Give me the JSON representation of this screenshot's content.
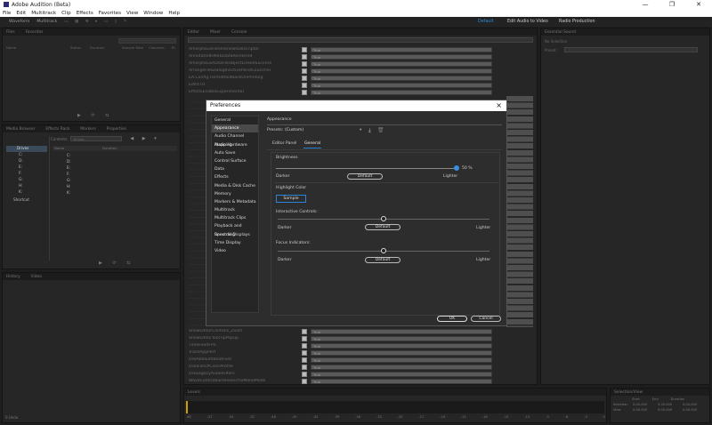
{
  "app": {
    "title": "Adobe Audition (Beta)"
  },
  "menu": [
    "File",
    "Edit",
    "Multitrack",
    "Clip",
    "Effects",
    "Favorites",
    "View",
    "Window",
    "Help"
  ],
  "toolbar": {
    "waveform": "Waveform",
    "multitrack": "Multitrack"
  },
  "workspaces": [
    "Default",
    "Edit Audio to Video",
    "Radio Production"
  ],
  "left_top_panel": {
    "tabs": [
      "Files",
      "Favorites"
    ],
    "columns": [
      "Name",
      "Status",
      "Duration",
      "Sample Rate",
      "Channels",
      "Bi"
    ]
  },
  "media_panel": {
    "tabs": [
      "Media Browser",
      "Effects Rack",
      "Markers",
      "Properties"
    ],
    "contents_label": "Contents:",
    "contents_value": "Drives",
    "col_name": "Name",
    "col_duration": "Duration",
    "tree": [
      "Drives",
      "C:",
      "D:",
      "E:",
      "F:",
      "G:",
      "H:",
      "K:",
      "Shortcut"
    ],
    "list": [
      "C:",
      "D:",
      "E:",
      "F:",
      "G:",
      "H:",
      "K:"
    ]
  },
  "history_panel": {
    "tabs": [
      "History",
      "Video"
    ],
    "status": "0 Undo"
  },
  "editor_panel": {
    "tabs": [
      "Editor",
      "Mixer",
      "Console"
    ]
  },
  "pref_rows": [
    "AmorphousFileUnknownDescriptor",
    "AnnotatedIsMetadataRendered",
    "AmorphousAutoFileObjectLinkedSuccess",
    "ArrangeFileDialogInactivePanelLauncher",
    "EA.Config.FormatRollBackOnPrinting",
    "EditXTO",
    "EffectsEnableExperimental"
  ],
  "pref_rows_bottom": [
    "ShowEditorControls_Zoom",
    "ShowEditorToolTipPopup",
    "TimeFeedFPS",
    "TraceAppPerf",
    "UseAbleEditBootFont",
    "UseIconOfColorProfile",
    "UseLegacyAudioFilters",
    "WaveControlBarReselectToMonoMode"
  ],
  "pref_value_placeholder": "True",
  "essential_panel": {
    "title": "Essential Sound",
    "sub": "No Selection",
    "preset": "Preset:"
  },
  "levels_panel": {
    "title": "Levels",
    "ticks": [
      "dB",
      "-57",
      "-54",
      "-51",
      "-48",
      "-45",
      "-42",
      "-39",
      "-36",
      "-33",
      "-30",
      "-27",
      "-24",
      "-21",
      "-18",
      "-15",
      "-12",
      "-9",
      "-6",
      "-3",
      "0"
    ]
  },
  "selection_panel": {
    "title": "Selection/View",
    "cols": [
      "Start",
      "End",
      "Duration"
    ],
    "rows": [
      {
        "label": "Selection",
        "vals": [
          "0:00.000",
          "0:00.000",
          "0:00.000"
        ]
      },
      {
        "label": "View",
        "vals": [
          "0:00.000",
          "0:00.000",
          "0:00.000"
        ]
      }
    ]
  },
  "dialog": {
    "title": "Preferences",
    "close": "×",
    "categories": [
      "General",
      "Appearance",
      "Audio Channel Mapping",
      "Audio Hardware",
      "Auto Save",
      "Control Surface",
      "Data",
      "Effects",
      "Media & Disk Cache",
      "Memory",
      "Markers & Metadata",
      "Multitrack",
      "Multitrack Clips",
      "Playback and Recording",
      "Spectral Displays",
      "Time Display",
      "Video"
    ],
    "selected_category": "Appearance",
    "section_title": "Appearance",
    "presets_label": "Presets:",
    "presets_value": "(Custom)",
    "tabs": [
      "Editor Panel",
      "General"
    ],
    "active_tab": "General",
    "brightness": {
      "label": "Brightness",
      "value_text": "50 %",
      "left": "Darker",
      "right": "Lighter",
      "default": "Default",
      "level": 50
    },
    "highlight": {
      "label": "Highlight Color",
      "sample": "Sample",
      "accent": "#2a82da"
    },
    "interactive": {
      "label": "Interactive Controls:",
      "left": "Darker",
      "right": "Lighter",
      "default": "Default",
      "level": 50
    },
    "focus": {
      "label": "Focus Indicators:",
      "left": "Darker",
      "right": "Lighter",
      "default": "Default",
      "level": 50
    },
    "ok": "OK",
    "cancel": "Cancel"
  }
}
